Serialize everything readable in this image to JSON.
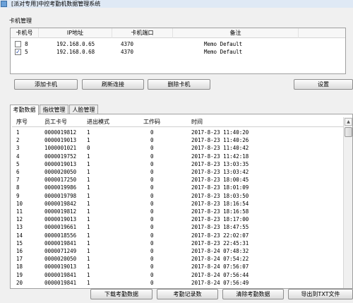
{
  "window": {
    "title": "[派对专用]中控考勤机数据管理系统"
  },
  "card_section": {
    "title": "卡机管理",
    "columns": [
      "卡机号",
      "IP地址",
      "卡机端口",
      "备注"
    ],
    "rows": [
      {
        "checked": false,
        "id": "8",
        "ip": "192.168.0.65",
        "port": "4370",
        "remark": "Memo Default"
      },
      {
        "checked": true,
        "id": "5",
        "ip": "192.168.0.68",
        "port": "4370",
        "remark": "Memo Default"
      }
    ]
  },
  "card_buttons": {
    "add": "添加卡机",
    "refresh": "刷新连接",
    "delete": "删除卡机",
    "settings": "设置"
  },
  "tabs": [
    "考勤数据",
    "指纹管理",
    "人脸管理"
  ],
  "attendance": {
    "columns": [
      "序号",
      "员工卡号",
      "进出模式",
      "工作码",
      "时间"
    ],
    "rows": [
      [
        "1",
        "0000019812",
        "1",
        "0",
        "2017-8-23 11:40:20"
      ],
      [
        "2",
        "0000019013",
        "1",
        "0",
        "2017-8-23 11:40:26"
      ],
      [
        "3",
        "1000001021",
        "0",
        "0",
        "2017-8-23 11:40:42"
      ],
      [
        "4",
        "0000019752",
        "1",
        "0",
        "2017-8-23 11:42:18"
      ],
      [
        "5",
        "0000019013",
        "1",
        "0",
        "2017-8-23 13:03:35"
      ],
      [
        "6",
        "0000020050",
        "1",
        "0",
        "2017-8-23 13:03:42"
      ],
      [
        "7",
        "0000017250",
        "1",
        "0",
        "2017-8-23 18:00:45"
      ],
      [
        "8",
        "0000019986",
        "1",
        "0",
        "2017-8-23 18:01:09"
      ],
      [
        "9",
        "0000019798",
        "1",
        "0",
        "2017-8-23 18:03:50"
      ],
      [
        "10",
        "0000019842",
        "1",
        "0",
        "2017-8-23 18:16:54"
      ],
      [
        "11",
        "0000019812",
        "1",
        "0",
        "2017-8-23 18:16:58"
      ],
      [
        "12",
        "0000019013",
        "1",
        "0",
        "2017-8-23 18:17:00"
      ],
      [
        "13",
        "0000019661",
        "1",
        "0",
        "2017-8-23 18:47:55"
      ],
      [
        "14",
        "0000018556",
        "1",
        "0",
        "2017-8-23 22:02:07"
      ],
      [
        "15",
        "0000019841",
        "1",
        "0",
        "2017-8-23 22:45:31"
      ],
      [
        "16",
        "0000071249",
        "1",
        "0",
        "2017-8-24 07:48:32"
      ],
      [
        "17",
        "0000020050",
        "1",
        "0",
        "2017-8-24 07:54:22"
      ],
      [
        "18",
        "0000019013",
        "1",
        "0",
        "2017-8-24 07:56:07"
      ],
      [
        "19",
        "0000019841",
        "1",
        "0",
        "2017-8-24 07:56:44"
      ],
      [
        "20",
        "0000019841",
        "1",
        "0",
        "2017-8-24 07:56:49"
      ]
    ]
  },
  "bottom_buttons": {
    "download": "下载考勤数据",
    "count": "考勤记录数",
    "clear": "清除考勤数据",
    "export": "导出到TXT文件"
  }
}
